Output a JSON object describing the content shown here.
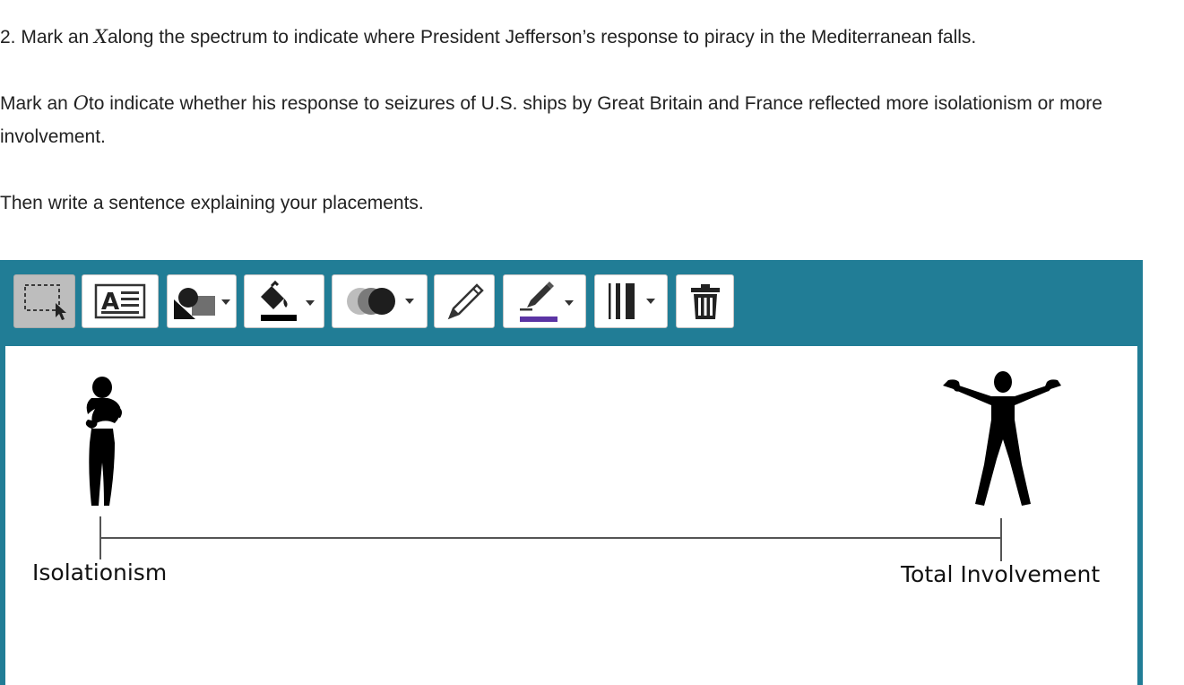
{
  "question": {
    "line1": {
      "prefix": "2. Mark an ",
      "mark": "X",
      "suffix": "along the spectrum to indicate where President Jefferson’s response to piracy in the Mediterranean falls."
    },
    "line2": {
      "prefix": "Mark an ",
      "mark": "O",
      "suffix": "to indicate whether his response to seizures of U.S. ships by Great Britain and France reflected more isolationism or more involvement."
    },
    "line3": "Then write a sentence explaining your placements."
  },
  "toolbar": {
    "tools": [
      {
        "name": "select-tool",
        "icon": "dashed-select-cursor-icon",
        "active": true
      },
      {
        "name": "text-tool",
        "icon": "text-box-icon"
      },
      {
        "name": "shapes-tool",
        "icon": "shapes-icon",
        "dropdown": true
      },
      {
        "name": "fill-color-tool",
        "icon": "paint-bucket-icon",
        "dropdown": true
      },
      {
        "name": "opacity-tool",
        "icon": "overlapping-circles-icon",
        "dropdown": true
      },
      {
        "name": "pencil-tool",
        "icon": "pencil-icon"
      },
      {
        "name": "line-color-tool",
        "icon": "pen-line-color-icon",
        "dropdown": true
      },
      {
        "name": "line-width-tool",
        "icon": "line-width-icon",
        "dropdown": true
      },
      {
        "name": "delete-tool",
        "icon": "trash-icon"
      }
    ],
    "accent_color": "#217d96",
    "line_color_swatch": "#5b34a4"
  },
  "spectrum": {
    "left_label": "Isolationism",
    "right_label": "Total Involvement"
  }
}
